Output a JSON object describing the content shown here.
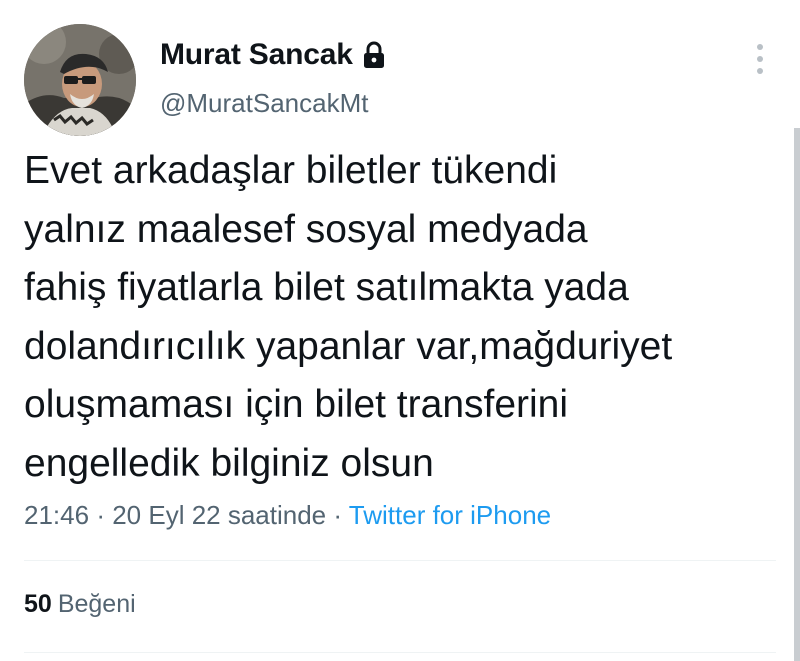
{
  "author": {
    "display_name": "Murat Sancak",
    "handle": "@MuratSancakMt",
    "protected_icon": "lock-icon",
    "avatar_icon": "profile-photo"
  },
  "menu": {
    "more_icon": "vertical-ellipsis-icon"
  },
  "tweet": {
    "text_lines": [
      "Evet arkadaşlar biletler tükendi",
      "yalnız maalesef sosyal medyada",
      "fahiş fiyatlarla bilet satılmakta yada",
      "dolandırıcılık yapanlar var,mağduriyet",
      "oluşmaması için bilet transferini",
      "engelledik bilginiz olsun"
    ]
  },
  "meta": {
    "time": "21:46",
    "separator": "·",
    "date": "20 Eyl 22 saatinde",
    "source": "Twitter for iPhone"
  },
  "engagement": {
    "likes_count": "50",
    "likes_label": "Beğeni"
  },
  "colors": {
    "text_primary": "#0f1419",
    "text_secondary": "#536471",
    "link": "#1d9bf0",
    "divider": "#eff3f4"
  }
}
